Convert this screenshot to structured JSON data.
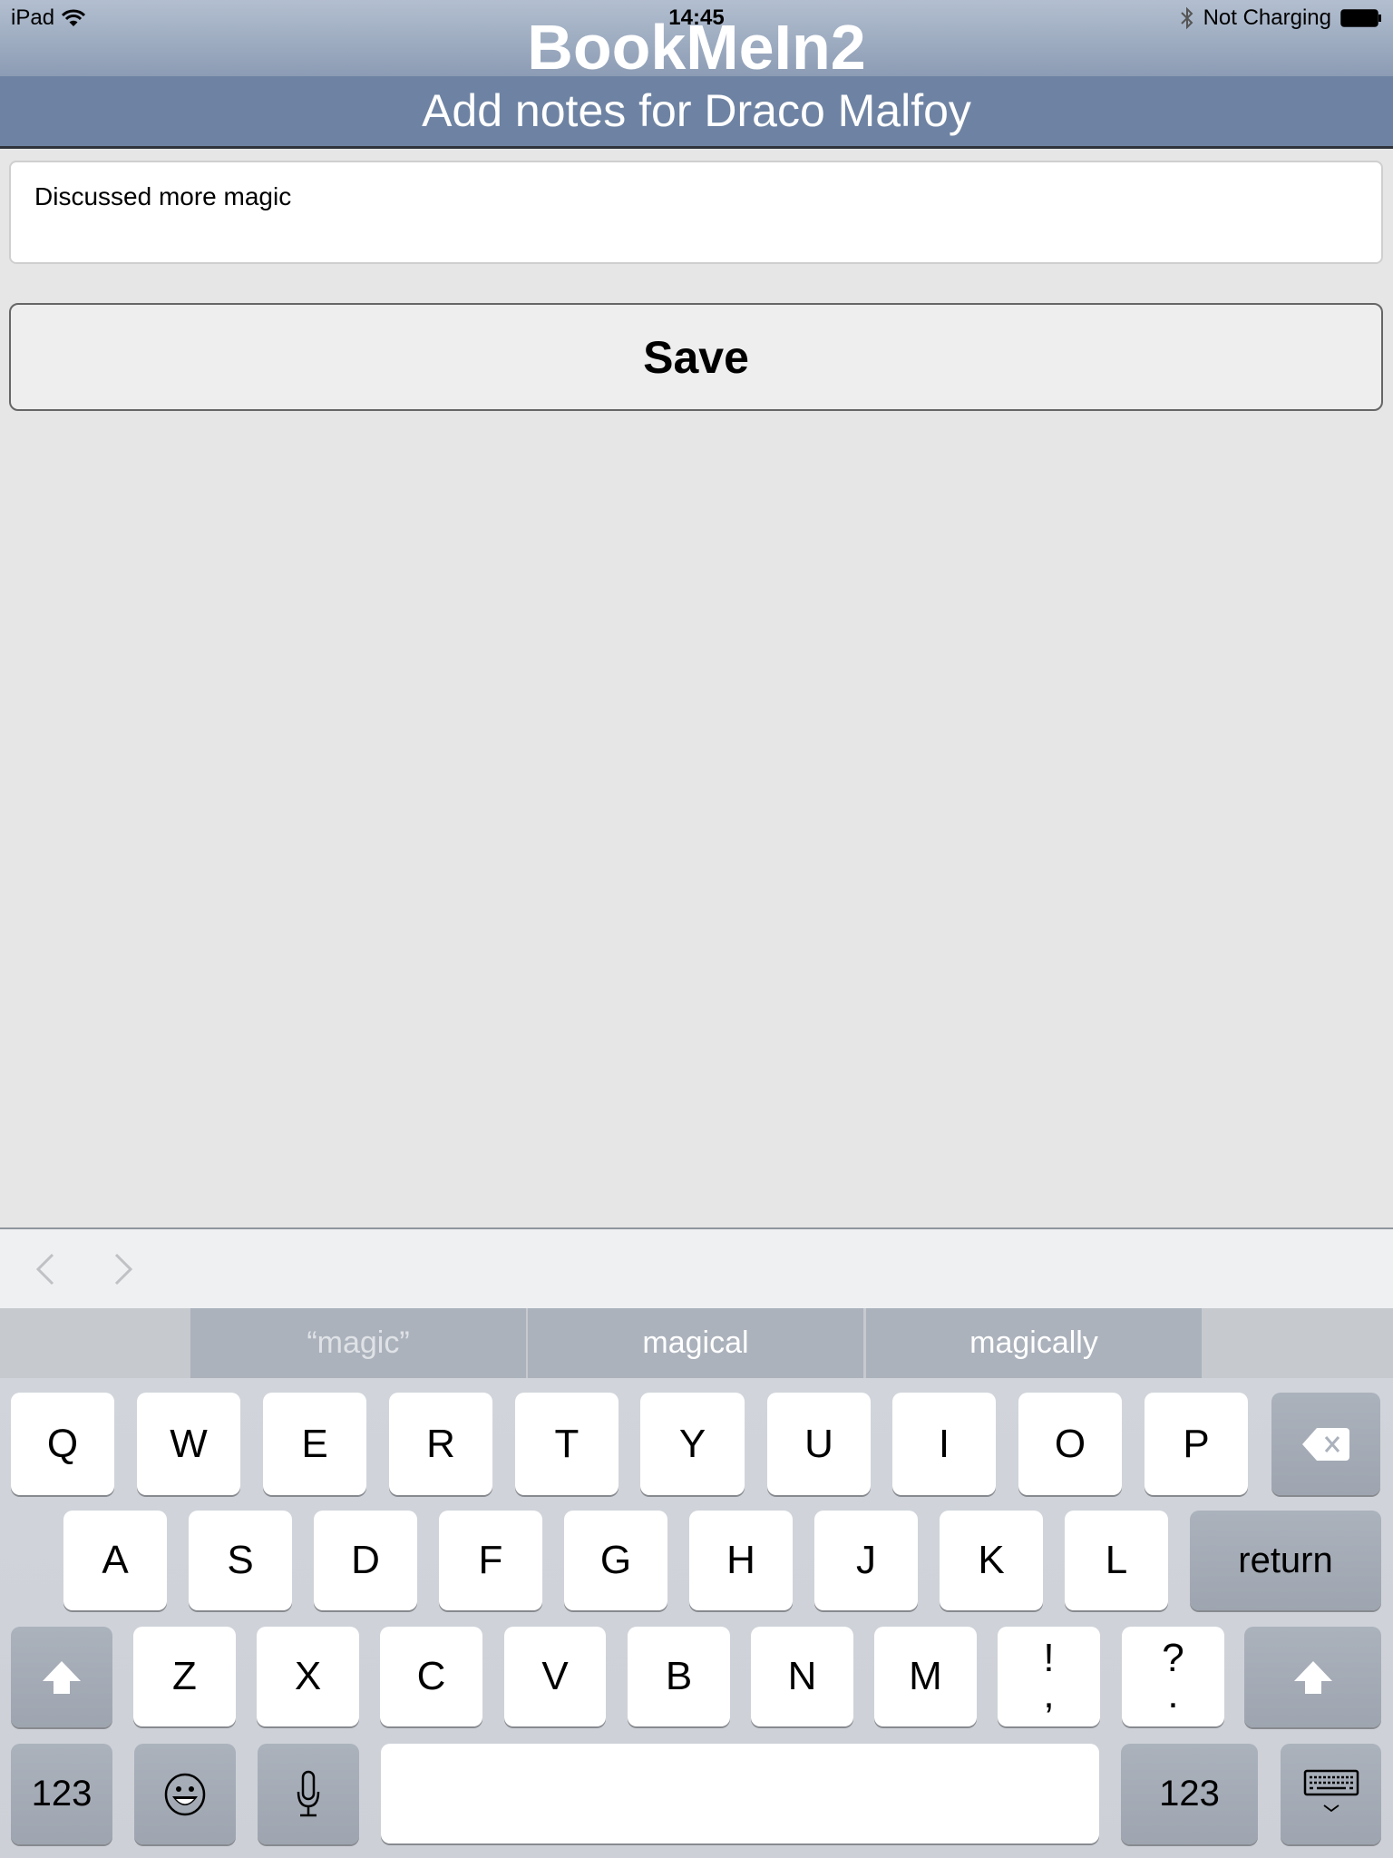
{
  "status_bar": {
    "device": "iPad",
    "time": "14:45",
    "charging_status": "Not Charging",
    "icons": [
      "wifi-icon",
      "bluetooth-icon",
      "battery-icon"
    ]
  },
  "header": {
    "app_title": "BookMeIn2",
    "subtitle": "Add notes for Draco Malfoy"
  },
  "form": {
    "notes_value": "Discussed more magic",
    "save_label": "Save"
  },
  "keyboard_accessory": {
    "prev_icon": "chevron-left-icon",
    "next_icon": "chevron-right-icon"
  },
  "predictions": [
    "“magic”",
    "magical",
    "magically"
  ],
  "keyboard": {
    "row1": [
      "Q",
      "W",
      "E",
      "R",
      "T",
      "Y",
      "U",
      "I",
      "O",
      "P"
    ],
    "row2": [
      "A",
      "S",
      "D",
      "F",
      "G",
      "H",
      "J",
      "K",
      "L"
    ],
    "row3": [
      "Z",
      "X",
      "C",
      "V",
      "B",
      "N",
      "M"
    ],
    "punct1": {
      "top": "!",
      "bottom": ","
    },
    "punct2": {
      "top": "?",
      "bottom": "."
    },
    "return_label": "return",
    "numbers_label": "123",
    "colors": {
      "letter_key": "#ffffff",
      "function_key": "#abb2bc",
      "background": "#d1d5db"
    }
  },
  "colors": {
    "header_band": "#6e83a3",
    "content_bg": "#e6e6e6"
  }
}
